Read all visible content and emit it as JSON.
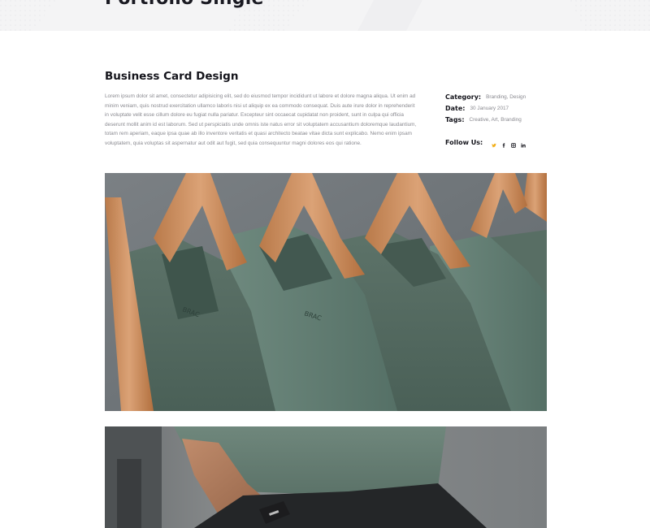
{
  "banner": {
    "title": "Portfolio Single"
  },
  "project": {
    "title": "Business Card Design",
    "description": "Lorem ipsum dolor sit amet, consectetur adipisicing elit, sed do eiusmod tempor incididunt ut labore et dolore magna aliqua. Ut enim ad minim veniam, quis nostrud exercitation ullamco laboris nisi ut aliquip ex ea commodo consequat. Duis aute irure dolor in reprehenderit in voluptate velit esse cillum dolore eu fugiat nulla pariatur. Excepteur sint occaecat cupidatat non proident, sunt in culpa qui officia deserunt mollit anim id est laborum. Sed ut perspiciatis unde omnis iste natus error sit voluptatem accusantium doloremque laudantium, totam rem aperiam, eaque ipsa quae ab illo inventore veritatis et quasi architecto beatae vitae dicta sunt explicabo. Nemo enim ipsam voluptatem, quia voluptas sit aspernatur aut odit aut fugit, sed quia consequuntur magni dolores eos qui ratione."
  },
  "meta": {
    "category_label": "Category:",
    "category_value": "Branding, Design",
    "date_label": "Date:",
    "date_value": "30 January 2017",
    "tags_label": "Tags:",
    "tags_value": "Creative, Art, Branding",
    "follow_label": "Follow Us:"
  },
  "social": [
    {
      "icon": "twitter-icon",
      "color": "#f2b01e"
    },
    {
      "icon": "facebook-icon",
      "color": "#15151c"
    },
    {
      "icon": "instagram-icon",
      "color": "#15151c"
    },
    {
      "icon": "linkedin-icon",
      "color": "#15151c"
    }
  ],
  "images": [
    {
      "name": "t-shirts-on-hangers-photo"
    },
    {
      "name": "person-in-green-tshirt-photo"
    }
  ]
}
